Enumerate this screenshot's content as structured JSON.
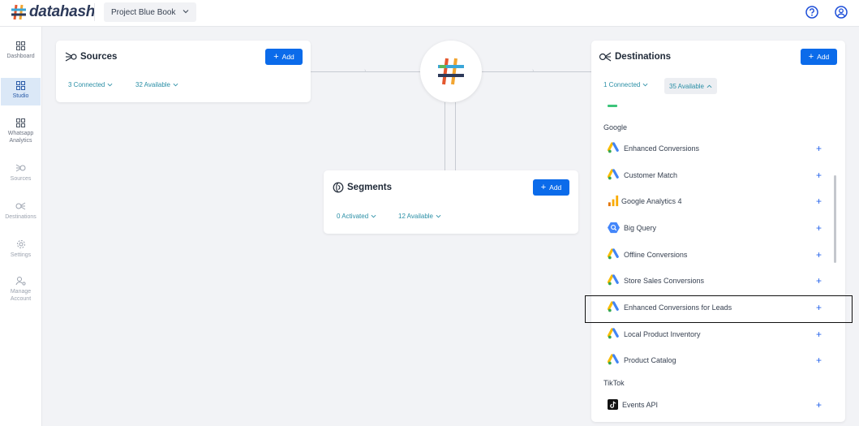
{
  "app": {
    "brand": "datahash",
    "project": "Project Blue Book"
  },
  "sidebar": {
    "items": [
      {
        "label": "Dashboard"
      },
      {
        "label": "Studio"
      },
      {
        "label": "Whatsapp Analytics"
      },
      {
        "label": "Sources"
      },
      {
        "label": "Destinations"
      },
      {
        "label": "Settings"
      },
      {
        "label": "Manage Account"
      }
    ]
  },
  "sources": {
    "title": "Sources",
    "add_label": "Add",
    "connected": "3 Connected",
    "available": "32 Available"
  },
  "segments": {
    "title": "Segments",
    "add_label": "Add",
    "activated": "0 Activated",
    "available": "12 Available"
  },
  "destinations": {
    "title": "Destinations",
    "add_label": "Add",
    "connected": "1 Connected",
    "available": "35 Available",
    "groups": [
      {
        "name": "Google",
        "items": [
          {
            "label": "Enhanced Conversions",
            "icon": "google-ads-icon"
          },
          {
            "label": "Customer Match",
            "icon": "google-ads-icon"
          },
          {
            "label": "Google Analytics 4",
            "icon": "google-analytics-icon"
          },
          {
            "label": "Big Query",
            "icon": "bigquery-icon"
          },
          {
            "label": "Offline Conversions",
            "icon": "google-ads-icon"
          },
          {
            "label": "Store Sales Conversions",
            "icon": "google-ads-icon"
          },
          {
            "label": "Enhanced Conversions for Leads",
            "icon": "google-ads-icon"
          },
          {
            "label": "Local Product Inventory",
            "icon": "google-ads-icon"
          },
          {
            "label": "Product Catalog",
            "icon": "google-ads-icon"
          }
        ]
      },
      {
        "name": "TikTok",
        "items": [
          {
            "label": "Events API",
            "icon": "tiktok-icon"
          }
        ]
      }
    ]
  },
  "colors": {
    "accent": "#0b6bea",
    "teal_text": "#2a8fa6",
    "sidebar_active": "#dbe8f7"
  }
}
